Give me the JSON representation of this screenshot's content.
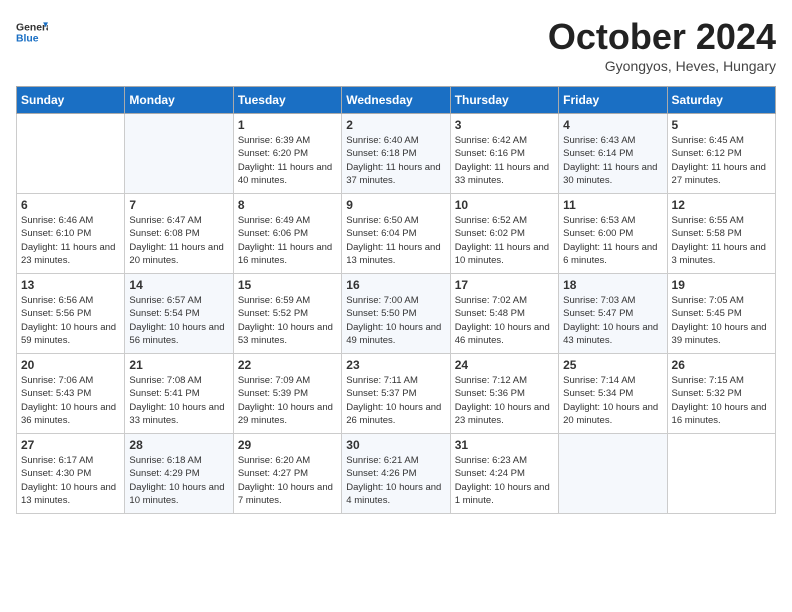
{
  "header": {
    "logo_line1": "General",
    "logo_line2": "Blue",
    "month": "October 2024",
    "location": "Gyongyos, Heves, Hungary"
  },
  "weekdays": [
    "Sunday",
    "Monday",
    "Tuesday",
    "Wednesday",
    "Thursday",
    "Friday",
    "Saturday"
  ],
  "weeks": [
    [
      {
        "day": "",
        "info": ""
      },
      {
        "day": "",
        "info": ""
      },
      {
        "day": "1",
        "info": "Sunrise: 6:39 AM\nSunset: 6:20 PM\nDaylight: 11 hours and 40 minutes."
      },
      {
        "day": "2",
        "info": "Sunrise: 6:40 AM\nSunset: 6:18 PM\nDaylight: 11 hours and 37 minutes."
      },
      {
        "day": "3",
        "info": "Sunrise: 6:42 AM\nSunset: 6:16 PM\nDaylight: 11 hours and 33 minutes."
      },
      {
        "day": "4",
        "info": "Sunrise: 6:43 AM\nSunset: 6:14 PM\nDaylight: 11 hours and 30 minutes."
      },
      {
        "day": "5",
        "info": "Sunrise: 6:45 AM\nSunset: 6:12 PM\nDaylight: 11 hours and 27 minutes."
      }
    ],
    [
      {
        "day": "6",
        "info": "Sunrise: 6:46 AM\nSunset: 6:10 PM\nDaylight: 11 hours and 23 minutes."
      },
      {
        "day": "7",
        "info": "Sunrise: 6:47 AM\nSunset: 6:08 PM\nDaylight: 11 hours and 20 minutes."
      },
      {
        "day": "8",
        "info": "Sunrise: 6:49 AM\nSunset: 6:06 PM\nDaylight: 11 hours and 16 minutes."
      },
      {
        "day": "9",
        "info": "Sunrise: 6:50 AM\nSunset: 6:04 PM\nDaylight: 11 hours and 13 minutes."
      },
      {
        "day": "10",
        "info": "Sunrise: 6:52 AM\nSunset: 6:02 PM\nDaylight: 11 hours and 10 minutes."
      },
      {
        "day": "11",
        "info": "Sunrise: 6:53 AM\nSunset: 6:00 PM\nDaylight: 11 hours and 6 minutes."
      },
      {
        "day": "12",
        "info": "Sunrise: 6:55 AM\nSunset: 5:58 PM\nDaylight: 11 hours and 3 minutes."
      }
    ],
    [
      {
        "day": "13",
        "info": "Sunrise: 6:56 AM\nSunset: 5:56 PM\nDaylight: 10 hours and 59 minutes."
      },
      {
        "day": "14",
        "info": "Sunrise: 6:57 AM\nSunset: 5:54 PM\nDaylight: 10 hours and 56 minutes."
      },
      {
        "day": "15",
        "info": "Sunrise: 6:59 AM\nSunset: 5:52 PM\nDaylight: 10 hours and 53 minutes."
      },
      {
        "day": "16",
        "info": "Sunrise: 7:00 AM\nSunset: 5:50 PM\nDaylight: 10 hours and 49 minutes."
      },
      {
        "day": "17",
        "info": "Sunrise: 7:02 AM\nSunset: 5:48 PM\nDaylight: 10 hours and 46 minutes."
      },
      {
        "day": "18",
        "info": "Sunrise: 7:03 AM\nSunset: 5:47 PM\nDaylight: 10 hours and 43 minutes."
      },
      {
        "day": "19",
        "info": "Sunrise: 7:05 AM\nSunset: 5:45 PM\nDaylight: 10 hours and 39 minutes."
      }
    ],
    [
      {
        "day": "20",
        "info": "Sunrise: 7:06 AM\nSunset: 5:43 PM\nDaylight: 10 hours and 36 minutes."
      },
      {
        "day": "21",
        "info": "Sunrise: 7:08 AM\nSunset: 5:41 PM\nDaylight: 10 hours and 33 minutes."
      },
      {
        "day": "22",
        "info": "Sunrise: 7:09 AM\nSunset: 5:39 PM\nDaylight: 10 hours and 29 minutes."
      },
      {
        "day": "23",
        "info": "Sunrise: 7:11 AM\nSunset: 5:37 PM\nDaylight: 10 hours and 26 minutes."
      },
      {
        "day": "24",
        "info": "Sunrise: 7:12 AM\nSunset: 5:36 PM\nDaylight: 10 hours and 23 minutes."
      },
      {
        "day": "25",
        "info": "Sunrise: 7:14 AM\nSunset: 5:34 PM\nDaylight: 10 hours and 20 minutes."
      },
      {
        "day": "26",
        "info": "Sunrise: 7:15 AM\nSunset: 5:32 PM\nDaylight: 10 hours and 16 minutes."
      }
    ],
    [
      {
        "day": "27",
        "info": "Sunrise: 6:17 AM\nSunset: 4:30 PM\nDaylight: 10 hours and 13 minutes."
      },
      {
        "day": "28",
        "info": "Sunrise: 6:18 AM\nSunset: 4:29 PM\nDaylight: 10 hours and 10 minutes."
      },
      {
        "day": "29",
        "info": "Sunrise: 6:20 AM\nSunset: 4:27 PM\nDaylight: 10 hours and 7 minutes."
      },
      {
        "day": "30",
        "info": "Sunrise: 6:21 AM\nSunset: 4:26 PM\nDaylight: 10 hours and 4 minutes."
      },
      {
        "day": "31",
        "info": "Sunrise: 6:23 AM\nSunset: 4:24 PM\nDaylight: 10 hours and 1 minute."
      },
      {
        "day": "",
        "info": ""
      },
      {
        "day": "",
        "info": ""
      }
    ]
  ]
}
